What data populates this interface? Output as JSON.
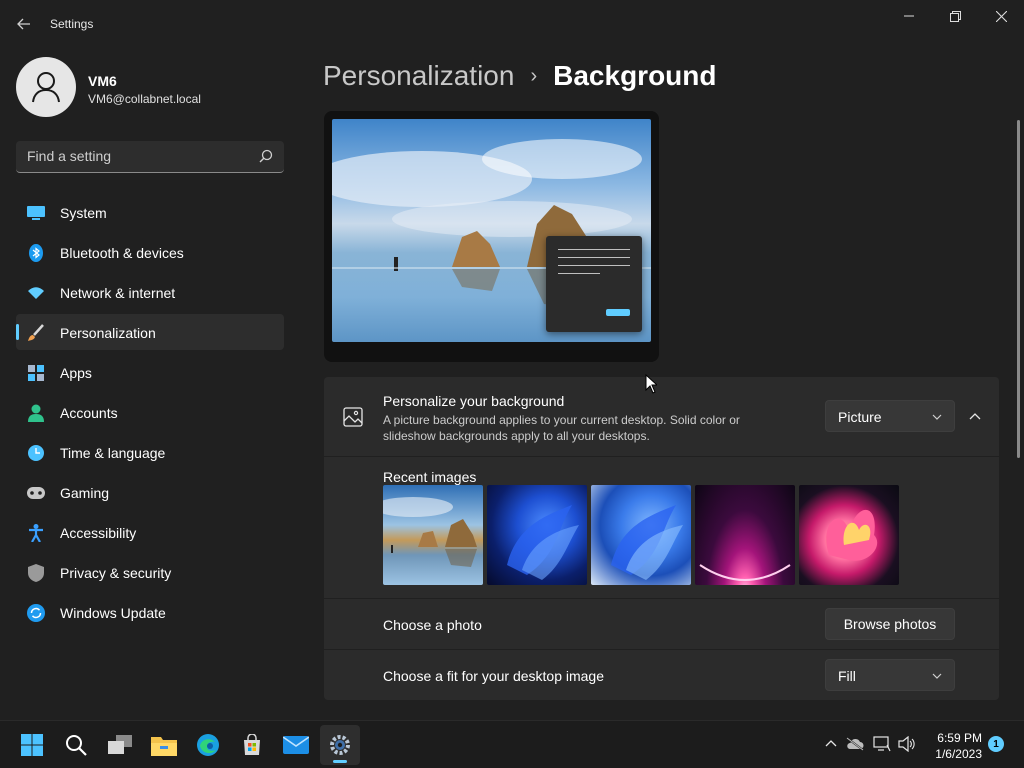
{
  "window": {
    "title": "Settings",
    "back_icon": "back-arrow-icon",
    "controls": [
      "minimize-icon",
      "maximize-icon",
      "close-icon"
    ]
  },
  "profile": {
    "name": "VM6",
    "email": "VM6@collabnet.local",
    "avatar_icon": "person-icon"
  },
  "search": {
    "placeholder": "Find a setting",
    "icon": "search-icon"
  },
  "nav": {
    "items": [
      {
        "label": "System",
        "icon": "monitor-icon",
        "color": "#4cc2ff"
      },
      {
        "label": "Bluetooth & devices",
        "icon": "bluetooth-icon",
        "color": "#1c9bf0"
      },
      {
        "label": "Network & internet",
        "icon": "wifi-icon",
        "color": "#60cdff"
      },
      {
        "label": "Personalization",
        "icon": "brush-icon",
        "color": "#f0a050",
        "active": true
      },
      {
        "label": "Apps",
        "icon": "apps-icon",
        "color": "#a7b8d0"
      },
      {
        "label": "Accounts",
        "icon": "account-icon",
        "color": "#2fc28c"
      },
      {
        "label": "Time & language",
        "icon": "clock-globe-icon",
        "color": "#4cc2ff"
      },
      {
        "label": "Gaming",
        "icon": "gamepad-icon",
        "color": "#c8c8c8"
      },
      {
        "label": "Accessibility",
        "icon": "accessibility-icon",
        "color": "#3aa0ff"
      },
      {
        "label": "Privacy & security",
        "icon": "shield-icon",
        "color": "#9a9a9a"
      },
      {
        "label": "Windows Update",
        "icon": "update-icon",
        "color": "#1f9bf0"
      }
    ]
  },
  "breadcrumb": {
    "parent": "Personalization",
    "separator": "›",
    "current": "Background"
  },
  "background": {
    "personalize": {
      "title": "Personalize your background",
      "description": "A picture background applies to your current desktop. Solid color or slideshow backgrounds apply to all your desktops.",
      "selected": "Picture",
      "icon": "image-icon",
      "expanded": true
    },
    "recent": {
      "label": "Recent images",
      "images": [
        "beach-rocks",
        "bloom-blue-dark",
        "bloom-blue-light",
        "glow-pink",
        "flower-pink"
      ]
    },
    "choose_photo": {
      "label": "Choose a photo",
      "button": "Browse photos"
    },
    "fit": {
      "label": "Choose a fit for your desktop image",
      "selected": "Fill"
    }
  },
  "taskbar": {
    "apps": [
      "windows-start-icon",
      "search-icon",
      "task-view-icon",
      "file-explorer-icon",
      "edge-icon",
      "store-icon",
      "mail-icon",
      "settings-icon"
    ],
    "active_app": "settings-icon",
    "tray": [
      "chevron-up-icon",
      "cloud-off-icon",
      "network-icon",
      "volume-icon"
    ],
    "time": "6:59 PM",
    "date": "1/6/2023",
    "notification_count": "1"
  },
  "colors": {
    "accent": "#60cdff",
    "background": "#202020",
    "card": "#2b2b2b",
    "taskbar": "#1c1c1c"
  }
}
